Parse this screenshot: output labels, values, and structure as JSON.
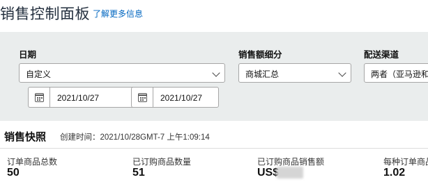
{
  "header": {
    "title": "销售控制面板",
    "learn_more": "了解更多信息"
  },
  "filters": {
    "date": {
      "label": "日期",
      "value": "自定义"
    },
    "breakdown": {
      "label": "销售额细分",
      "value": "商城汇总"
    },
    "channel": {
      "label": "配送渠道",
      "value": "两者（亚马逊和卖家）"
    },
    "start_date": "2021/10/27",
    "end_date": "2021/10/27"
  },
  "snapshot": {
    "title": "销售快照",
    "created": "创建时间：2021/10/28GMT-7 上午1:09:14",
    "metrics": [
      {
        "label": "订单商品总数",
        "value": "50"
      },
      {
        "label": "已订购商品数量",
        "value": "51"
      },
      {
        "label": "已订购商品销售额",
        "value": "US$"
      },
      {
        "label": "每种订单商品",
        "value": "1.02"
      }
    ]
  },
  "icons": {
    "calendar": "calendar-icon",
    "dropdown": "chevron-down-icon"
  }
}
